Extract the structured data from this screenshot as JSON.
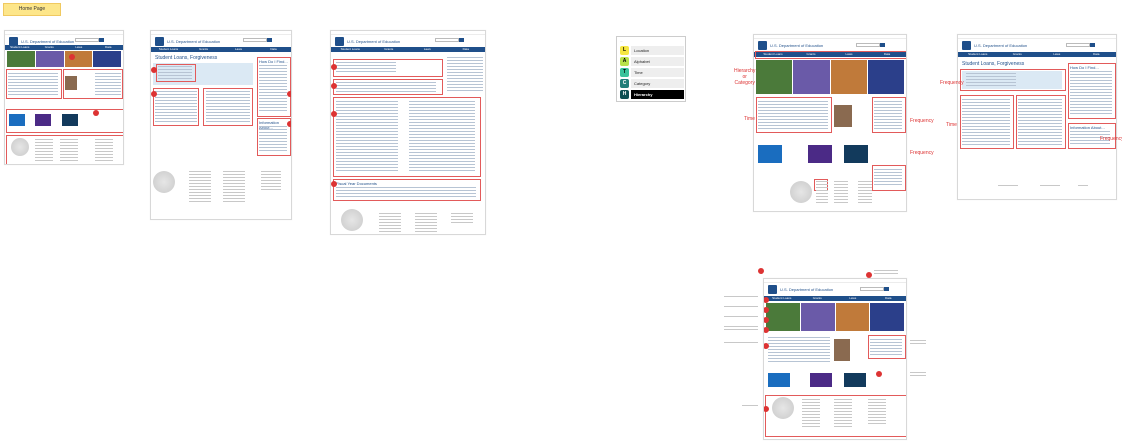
{
  "tag": "Home Page",
  "org": "U.S. Department of Education",
  "nav": [
    "Student Loans",
    "Grants",
    "Laws",
    "Data"
  ],
  "titles": {
    "student_loans": "Student Loans, Forgiveness",
    "find": "How Do I Find...",
    "info": "Information About...",
    "fiscal": "Fiscal Year Documents"
  },
  "legend": {
    "caption": "...",
    "items": [
      {
        "key": "L",
        "label": "Location",
        "color": "#f5e642"
      },
      {
        "key": "A",
        "label": "Alphabet",
        "color": "#b9e24a"
      },
      {
        "key": "T",
        "label": "Time",
        "color": "#39c29a"
      },
      {
        "key": "C",
        "label": "Category",
        "color": "#1f7d78"
      },
      {
        "key": "H",
        "label": "Hierarchy",
        "color": "#0d4f53"
      }
    ]
  },
  "labels": {
    "hierarchy_category": "Hierarchy\nor\nCategory",
    "time": "Time",
    "frequency": "Frequency"
  },
  "colors": {
    "brand": "#1f4f8a",
    "annotation": "#d33",
    "tag": "#fde68a"
  }
}
